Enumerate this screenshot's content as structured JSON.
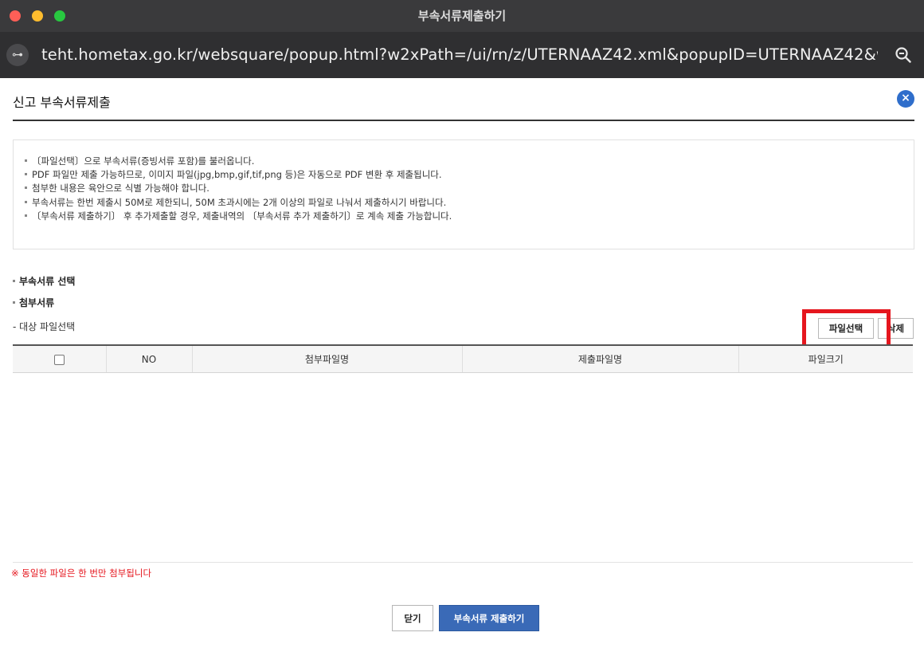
{
  "window": {
    "title": "부속서류제출하기",
    "url": "teht.hometax.go.kr/websquare/popup.html?w2xPath=/ui/rn/z/UTERNAAZ42.xml&popupID=UTERNAAZ42&w...",
    "site_settings_icon": "⊶",
    "zoom_icon": "zoom-magnifier-icon"
  },
  "popup": {
    "title": "신고 부속서류제출",
    "close_icon": "×"
  },
  "notices": [
    "〔파일선택〕으로 부속서류(증빙서류 포함)를 불러옵니다.",
    "PDF 파일만 제출 가능하므로, 이미지 파일(jpg,bmp,gif,tif,png 등)은 자동으로 PDF 변환 후 제출됩니다.",
    "첨부한 내용은 육안으로 식별 가능해야 합니다.",
    "부속서류는 한번 제출시 50M로 제한되니, 50M 초과시에는 2개 이상의 파일로 나눠서 제출하시기 바랍니다.",
    "〔부속서류 제출하기〕 후 추가제출할 경우, 제출내역의 〔부속서류 추가 제출하기〕로 계속 제출 가능합니다."
  ],
  "sections": {
    "select_label": "부속서류 선택",
    "attach_label": "첨부서류",
    "target_label": "- 대상 파일선택"
  },
  "buttons": {
    "file_select": "파일선택",
    "delete": "삭제",
    "close": "닫기",
    "submit": "부속서류 제출하기"
  },
  "table": {
    "columns": [
      "",
      "NO",
      "첨부파일명",
      "제출파일명",
      "파일크기"
    ],
    "rows": []
  },
  "warning": "※ 동일한 파일은 한 번만 첨부됩니다",
  "colors": {
    "accent": "#3a6ab7",
    "close_icon_bg": "#2f6ecb",
    "warning": "#e5161e",
    "highlight": "#e5161e",
    "titlebar": "#3a3a3c"
  }
}
